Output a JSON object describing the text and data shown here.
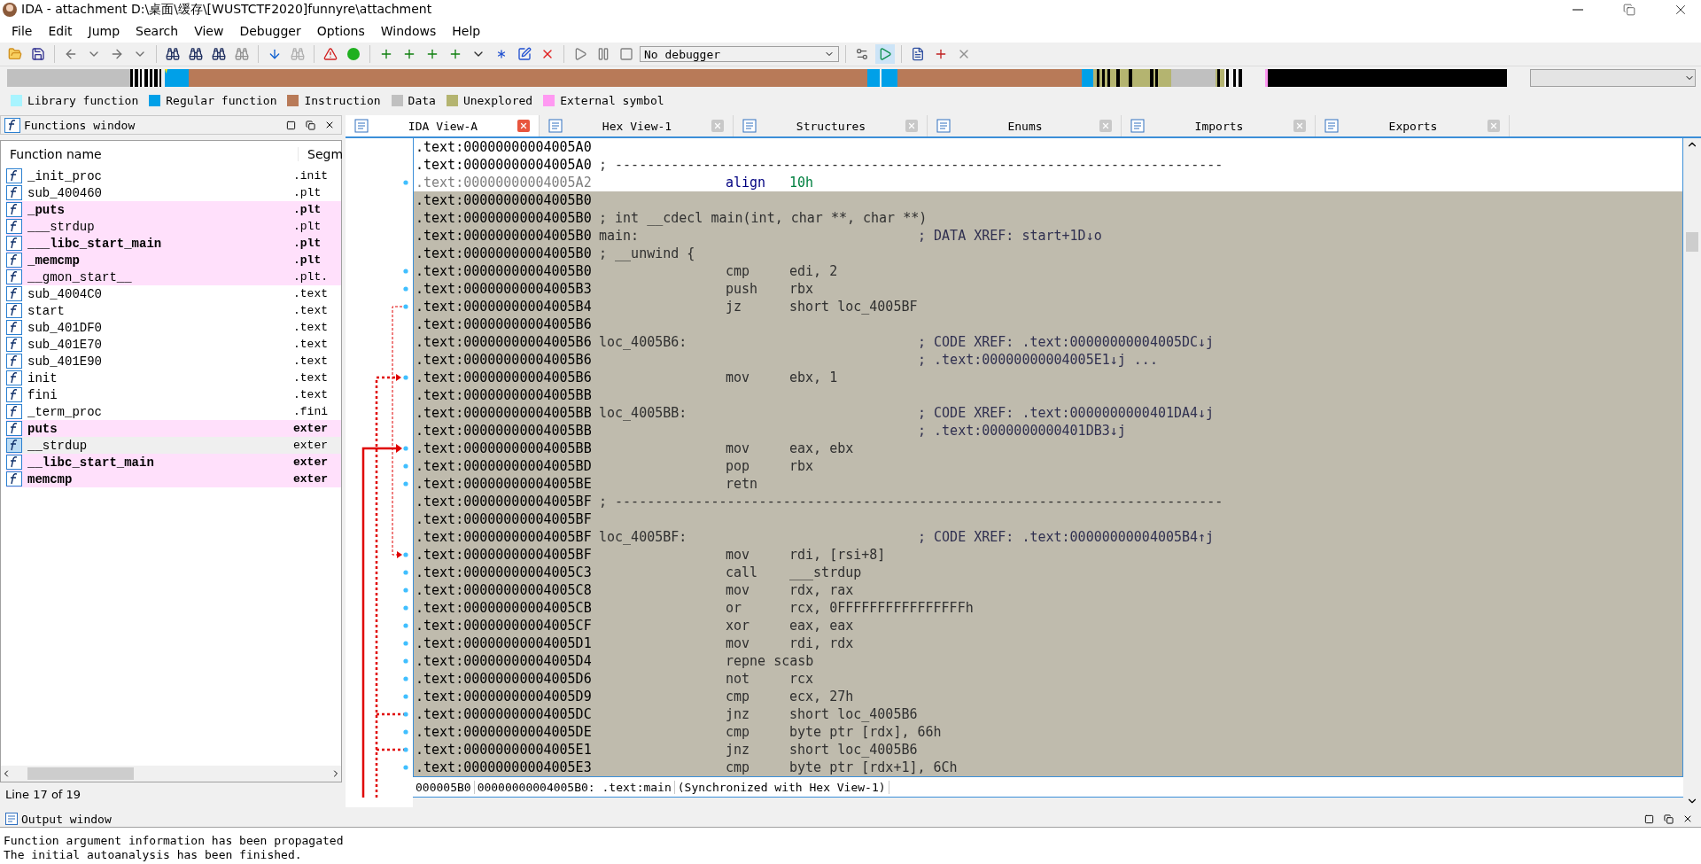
{
  "window": {
    "title": "IDA - attachment D:\\桌面\\缓存\\[WUSTCTF2020]funnyre\\attachment"
  },
  "menu": [
    "File",
    "Edit",
    "Jump",
    "Search",
    "View",
    "Debugger",
    "Options",
    "Windows",
    "Help"
  ],
  "toolbar": {
    "debugger": "No debugger"
  },
  "legend": [
    {
      "label": "Library function",
      "color": "#a8f4ff"
    },
    {
      "label": "Regular function",
      "color": "#00a0e8"
    },
    {
      "label": "Instruction",
      "color": "#b87a58"
    },
    {
      "label": "Data",
      "color": "#c0c0c0"
    },
    {
      "label": "Unexplored",
      "color": "#b4b470"
    },
    {
      "label": "External symbol",
      "color": "#ff99f2"
    }
  ],
  "functions_window": {
    "title": "Functions window",
    "columns": [
      "Function name",
      "Segm"
    ],
    "rows": [
      {
        "name": "_init_proc",
        "segment": ".init",
        "external": false,
        "bold": false,
        "selected": false
      },
      {
        "name": "sub_400460",
        "segment": ".plt",
        "external": false,
        "bold": false,
        "selected": false
      },
      {
        "name": "_puts",
        "segment": ".plt",
        "external": true,
        "bold": true,
        "selected": false
      },
      {
        "name": "___strdup",
        "segment": ".plt",
        "external": true,
        "bold": false,
        "selected": false
      },
      {
        "name": "___libc_start_main",
        "segment": ".plt",
        "external": true,
        "bold": true,
        "selected": false
      },
      {
        "name": "_memcmp",
        "segment": ".plt",
        "external": true,
        "bold": true,
        "selected": false
      },
      {
        "name": "__gmon_start__",
        "segment": ".plt.",
        "external": true,
        "bold": false,
        "selected": false
      },
      {
        "name": "sub_4004C0",
        "segment": ".text",
        "external": false,
        "bold": false,
        "selected": false
      },
      {
        "name": "start",
        "segment": ".text",
        "external": false,
        "bold": false,
        "selected": false
      },
      {
        "name": "sub_401DF0",
        "segment": ".text",
        "external": false,
        "bold": false,
        "selected": false
      },
      {
        "name": "sub_401E70",
        "segment": ".text",
        "external": false,
        "bold": false,
        "selected": false
      },
      {
        "name": "sub_401E90",
        "segment": ".text",
        "external": false,
        "bold": false,
        "selected": false
      },
      {
        "name": "init",
        "segment": ".text",
        "external": false,
        "bold": false,
        "selected": false
      },
      {
        "name": "fini",
        "segment": ".text",
        "external": false,
        "bold": false,
        "selected": false
      },
      {
        "name": "_term_proc",
        "segment": ".fini",
        "external": false,
        "bold": false,
        "selected": false
      },
      {
        "name": "puts",
        "segment": "exter",
        "external": true,
        "bold": true,
        "selected": false
      },
      {
        "name": "__strdup",
        "segment": "exter",
        "external": false,
        "bold": false,
        "selected": true
      },
      {
        "name": "__libc_start_main",
        "segment": "exter",
        "external": true,
        "bold": true,
        "selected": false
      },
      {
        "name": "memcmp",
        "segment": "exter",
        "external": true,
        "bold": true,
        "selected": false
      }
    ],
    "status": "Line 17 of 19"
  },
  "tabs": [
    {
      "label": "IDA View-A",
      "selected": true
    },
    {
      "label": "Hex View-1",
      "selected": false
    },
    {
      "label": "Structures",
      "selected": false
    },
    {
      "label": "Enums",
      "selected": false
    },
    {
      "label": "Imports",
      "selected": false
    },
    {
      "label": "Exports",
      "selected": false
    }
  ],
  "disassembly": {
    "lines": [
      {
        "kind": "blank",
        "addr": ".text:00000000004005A0",
        "highlighted": false,
        "dim": false
      },
      {
        "kind": "note",
        "addr": ".text:00000000004005A0",
        "note": "; ----------------------------------------------------------------------------",
        "highlighted": false,
        "dim": false
      },
      {
        "kind": "directive",
        "addr": ".text:00000000004005A2",
        "mnem": "align",
        "ops": "10h",
        "highlighted": false,
        "dim": true
      },
      {
        "kind": "blank",
        "addr": ".text:00000000004005B0",
        "highlighted": true,
        "dim": false
      },
      {
        "kind": "note",
        "addr": ".text:00000000004005B0",
        "note": "; int __cdecl main(int, char **, char **)",
        "highlighted": true,
        "dim": false
      },
      {
        "kind": "label",
        "addr": ".text:00000000004005B0",
        "label": "main:",
        "comment": "; DATA XREF: start+1D↓o",
        "highlighted": true,
        "dim": false
      },
      {
        "kind": "note",
        "addr": ".text:00000000004005B0",
        "note": "; __unwind {",
        "highlighted": true,
        "dim": false
      },
      {
        "kind": "instruction",
        "addr": ".text:00000000004005B0",
        "mnem": "cmp",
        "ops": "edi, 2",
        "highlighted": true,
        "dim": false
      },
      {
        "kind": "instruction",
        "addr": ".text:00000000004005B3",
        "mnem": "push",
        "ops": "rbx",
        "highlighted": true,
        "dim": false
      },
      {
        "kind": "instruction",
        "addr": ".text:00000000004005B4",
        "mnem": "jz",
        "ops": "short loc_4005BF",
        "highlighted": true,
        "dim": false
      },
      {
        "kind": "blank",
        "addr": ".text:00000000004005B6",
        "highlighted": true,
        "dim": false
      },
      {
        "kind": "label",
        "addr": ".text:00000000004005B6",
        "label": "loc_4005B6:",
        "comment": "; CODE XREF: .text:00000000004005DC↓j",
        "highlighted": true,
        "dim": false
      },
      {
        "kind": "label",
        "addr": ".text:00000000004005B6",
        "comment": "; .text:00000000004005E1↓j ...",
        "highlighted": true,
        "dim": false
      },
      {
        "kind": "instruction",
        "addr": ".text:00000000004005B6",
        "mnem": "mov",
        "ops": "ebx, 1",
        "highlighted": true,
        "dim": false
      },
      {
        "kind": "blank",
        "addr": ".text:00000000004005BB",
        "highlighted": true,
        "dim": false
      },
      {
        "kind": "label",
        "addr": ".text:00000000004005BB",
        "label": "loc_4005BB:",
        "comment": "; CODE XREF: .text:0000000000401DA4↓j",
        "highlighted": true,
        "dim": false
      },
      {
        "kind": "label",
        "addr": ".text:00000000004005BB",
        "comment": "; .text:0000000000401DB3↓j",
        "highlighted": true,
        "dim": false
      },
      {
        "kind": "instruction",
        "addr": ".text:00000000004005BB",
        "mnem": "mov",
        "ops": "eax, ebx",
        "highlighted": true,
        "dim": false
      },
      {
        "kind": "instruction",
        "addr": ".text:00000000004005BD",
        "mnem": "pop",
        "ops": "rbx",
        "highlighted": true,
        "dim": false
      },
      {
        "kind": "instruction",
        "addr": ".text:00000000004005BE",
        "mnem": "retn",
        "highlighted": true,
        "dim": false
      },
      {
        "kind": "note",
        "addr": ".text:00000000004005BF",
        "note": "; ----------------------------------------------------------------------------",
        "highlighted": true,
        "dim": false
      },
      {
        "kind": "blank",
        "addr": ".text:00000000004005BF",
        "highlighted": true,
        "dim": false
      },
      {
        "kind": "label",
        "addr": ".text:00000000004005BF",
        "label": "loc_4005BF:",
        "comment": "; CODE XREF: .text:00000000004005B4↑j",
        "highlighted": true,
        "dim": false
      },
      {
        "kind": "instruction",
        "addr": ".text:00000000004005BF",
        "mnem": "mov",
        "ops": "rdi, [rsi+8]",
        "highlighted": true,
        "dim": false
      },
      {
        "kind": "instruction",
        "addr": ".text:00000000004005C3",
        "mnem": "call",
        "ops": "___strdup",
        "highlighted": true,
        "dim": false
      },
      {
        "kind": "instruction",
        "addr": ".text:00000000004005C8",
        "mnem": "mov",
        "ops": "rdx, rax",
        "highlighted": true,
        "dim": false
      },
      {
        "kind": "instruction",
        "addr": ".text:00000000004005CB",
        "mnem": "or",
        "ops": "rcx, 0FFFFFFFFFFFFFFFFh",
        "highlighted": true,
        "dim": false
      },
      {
        "kind": "instruction",
        "addr": ".text:00000000004005CF",
        "mnem": "xor",
        "ops": "eax, eax",
        "highlighted": true,
        "dim": false
      },
      {
        "kind": "instruction",
        "addr": ".text:00000000004005D1",
        "mnem": "mov",
        "ops": "rdi, rdx",
        "highlighted": true,
        "dim": false
      },
      {
        "kind": "instruction",
        "addr": ".text:00000000004005D4",
        "mnem": "repne scasb",
        "highlighted": true,
        "dim": false
      },
      {
        "kind": "instruction",
        "addr": ".text:00000000004005D6",
        "mnem": "not",
        "ops": "rcx",
        "highlighted": true,
        "dim": false
      },
      {
        "kind": "instruction",
        "addr": ".text:00000000004005D9",
        "mnem": "cmp",
        "ops": "ecx, 27h",
        "highlighted": true,
        "dim": false
      },
      {
        "kind": "instruction",
        "addr": ".text:00000000004005DC",
        "mnem": "jnz",
        "ops": "short loc_4005B6",
        "highlighted": true,
        "dim": false
      },
      {
        "kind": "instruction",
        "addr": ".text:00000000004005DE",
        "mnem": "cmp",
        "ops": "byte ptr [rdx], 66h",
        "highlighted": true,
        "dim": false
      },
      {
        "kind": "instruction",
        "addr": ".text:00000000004005E1",
        "mnem": "jnz",
        "ops": "short loc_4005B6",
        "highlighted": true,
        "dim": false
      },
      {
        "kind": "instruction",
        "addr": ".text:00000000004005E3",
        "mnem": "cmp",
        "ops": "byte ptr [rdx+1], 6Ch",
        "highlighted": true,
        "dim": false
      }
    ],
    "status": [
      "000005B0",
      "00000000004005B0: .text:main",
      "(Synchronized with Hex View-1)"
    ]
  },
  "output_window": {
    "title": "Output window",
    "lines": [
      "Function argument information has been propagated",
      "The initial autoanalysis has been finished."
    ]
  }
}
